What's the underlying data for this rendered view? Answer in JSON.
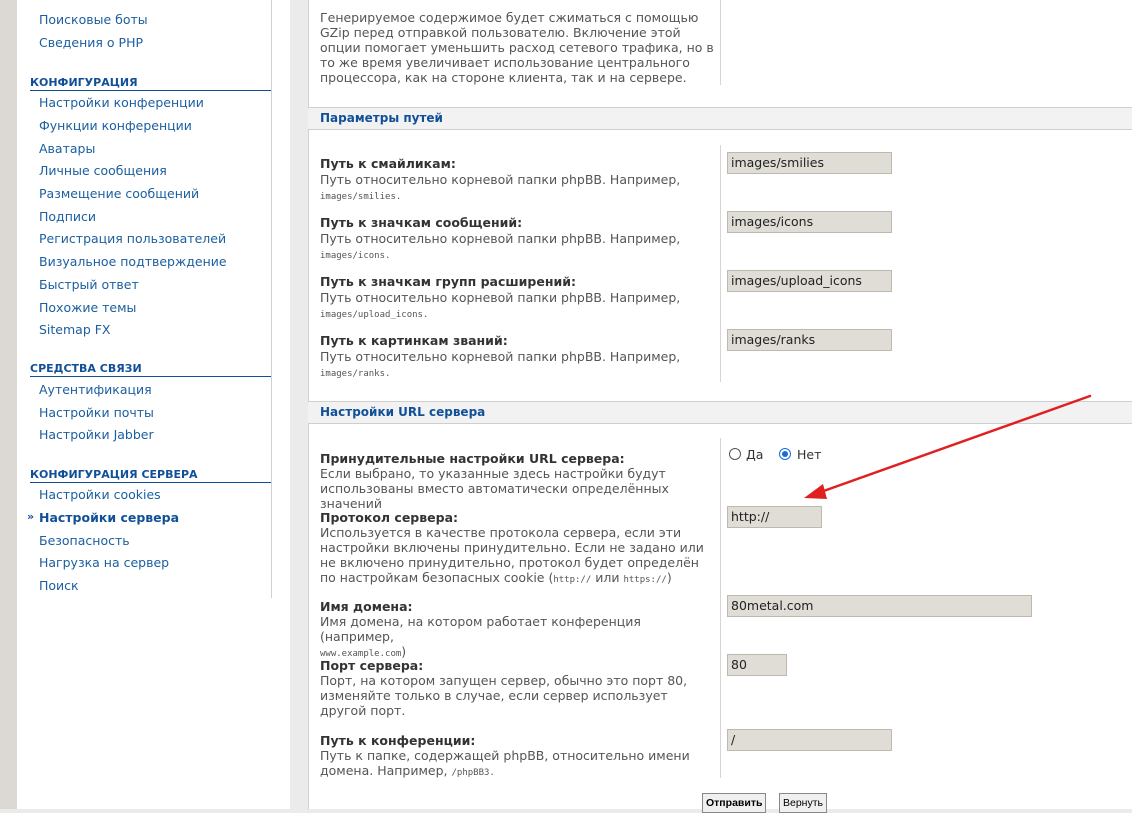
{
  "sidebar": {
    "top_links": [
      "Поисковые боты",
      "Сведения о PHP"
    ],
    "sections": [
      {
        "title": "КОНФИГУРАЦИЯ",
        "items": [
          "Настройки конференции",
          "Функции конференции",
          "Аватары",
          "Личные сообщения",
          "Размещение сообщений",
          "Подписи",
          "Регистрация пользователей",
          "Визуальное подтверждение",
          "Быстрый ответ",
          "Похожие темы",
          "Sitemap FX"
        ]
      },
      {
        "title": "СРЕДСТВА СВЯЗИ",
        "items": [
          "Аутентификация",
          "Настройки почты",
          "Настройки Jabber"
        ]
      },
      {
        "title": "КОНФИГУРАЦИЯ СЕРВЕРА",
        "items": [
          "Настройки cookies",
          "Настройки сервера",
          "Безопасность",
          "Нагрузка на сервер",
          "Поиск"
        ],
        "active": "Настройки сервера"
      }
    ]
  },
  "gzip": {
    "desc": "Генерируемое содержимое будет сжиматься с помощью GZip перед отправкой пользователю. Включение этой опции помогает уменьшить расход сетевого трафика, но в то же время увеличивает использование центрального процессора, как на стороне клиента, так и на сервере."
  },
  "paths": {
    "title": "Параметры путей",
    "rows": [
      {
        "label": "Путь к смайликам:",
        "desc": "Путь относительно корневой папки phpBB. Например,",
        "example": "images/smilies.",
        "value": "images/smilies"
      },
      {
        "label": "Путь к значкам сообщений:",
        "desc": "Путь относительно корневой папки phpBB. Например,",
        "example": "images/icons.",
        "value": "images/icons"
      },
      {
        "label": "Путь к значкам групп расширений:",
        "desc": "Путь относительно корневой папки phpBB. Например,",
        "example": "images/upload_icons.",
        "value": "images/upload_icons"
      },
      {
        "label": "Путь к картинкам званий:",
        "desc": "Путь относительно корневой папки phpBB. Например,",
        "example": "images/ranks.",
        "value": "images/ranks"
      }
    ]
  },
  "server_url": {
    "title": "Настройки URL сервера",
    "force": {
      "label": "Принудительные настройки URL сервера:",
      "desc": "Если выбрано, то указанные здесь настройки будут использованы вместо автоматически определённых значений",
      "yes": "Да",
      "no": "Нет",
      "selected": "Нет"
    },
    "protocol": {
      "label": "Протокол сервера:",
      "desc": "Используется в качестве протокола сервера, если эти настройки включены принудительно. Если не задано или не включено принудительно, протокол будет определён по настройкам безопасных cookie (",
      "code1": "http://",
      "or": " или ",
      "code2": "https://",
      "close": ")",
      "value": "http://"
    },
    "domain": {
      "label": "Имя домена:",
      "desc": "Имя домена, на котором работает конференция (например,",
      "example": "www.example.com",
      "close": ")",
      "value": "80metal.com"
    },
    "port": {
      "label": "Порт сервера:",
      "desc": "Порт, на котором запущен сервер, обычно это порт 80, изменяйте только в случае, если сервер использует другой порт.",
      "value": "80"
    },
    "script_path": {
      "label": "Путь к конференции:",
      "desc": "Путь к папке, содержащей phpBB, относительно имени домена. Например,",
      "example": "/phpBB3.",
      "value": "/"
    }
  },
  "buttons": {
    "submit": "Отправить",
    "reset": "Вернуть"
  },
  "annotation_color": "#e02020"
}
